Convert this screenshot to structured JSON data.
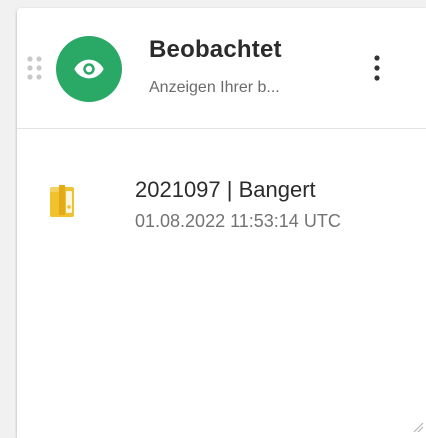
{
  "widget": {
    "title": "Beobachtet",
    "subtitle": "Anzeigen Ihrer b...",
    "accent_color": "#2aa866",
    "header_icon": "eye-icon",
    "menu_icon": "more-vertical-icon",
    "drag_icon": "drag-handle-icon"
  },
  "items": [
    {
      "title": "2021097 | Bangert",
      "timestamp": "01.08.2022 11:53:14 UTC",
      "icon": "binder-icon",
      "icon_color": "#f2c12e"
    }
  ]
}
